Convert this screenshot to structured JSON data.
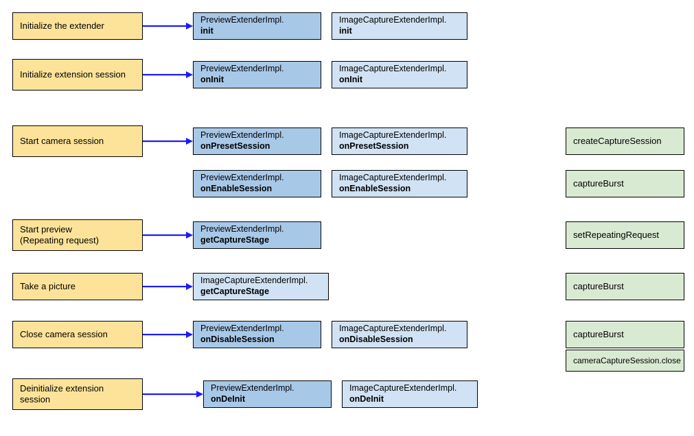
{
  "phases": [
    {
      "id": "init-extender",
      "label": "Initialize the extender"
    },
    {
      "id": "init-session",
      "label": "Initialize extension session"
    },
    {
      "id": "start-camera",
      "label": "Start camera session"
    },
    {
      "id": "start-preview",
      "label": "Start preview\n(Repeating request)"
    },
    {
      "id": "take-picture",
      "label": "Take a picture"
    },
    {
      "id": "close-camera",
      "label": "Close camera session"
    },
    {
      "id": "deinit-session",
      "label": "Deinitialize extension session"
    }
  ],
  "preview": {
    "class": "PreviewExtenderImpl.",
    "methods": {
      "init": "init",
      "onInit": "onInit",
      "onPreset": "onPresetSession",
      "onEnable": "onEnableSession",
      "getCapture": "getCaptureStage",
      "onDisable": "onDisableSession",
      "onDeInit": "onDeInit"
    }
  },
  "capture": {
    "class": "ImageCaptureExtenderImpl.",
    "methods": {
      "init": "init",
      "onInit": "onInit",
      "onPreset": "onPresetSession",
      "onEnable": "onEnableSession",
      "getCapture": "getCaptureStage",
      "onDisable": "onDisableSession",
      "onDeInit": "onDeInit"
    }
  },
  "camera2": {
    "createSession": "createCaptureSession",
    "burst1": "captureBurst",
    "repeating": "setRepeatingRequest",
    "burst2": "captureBurst",
    "burst3": "captureBurst",
    "close": "cameraCaptureSession.close"
  },
  "colors": {
    "yellow": "#fde399",
    "blue": "#a8c8e8",
    "lblue": "#d0e2f3",
    "green": "#d9ead3",
    "arrow": "#1b1bff"
  }
}
